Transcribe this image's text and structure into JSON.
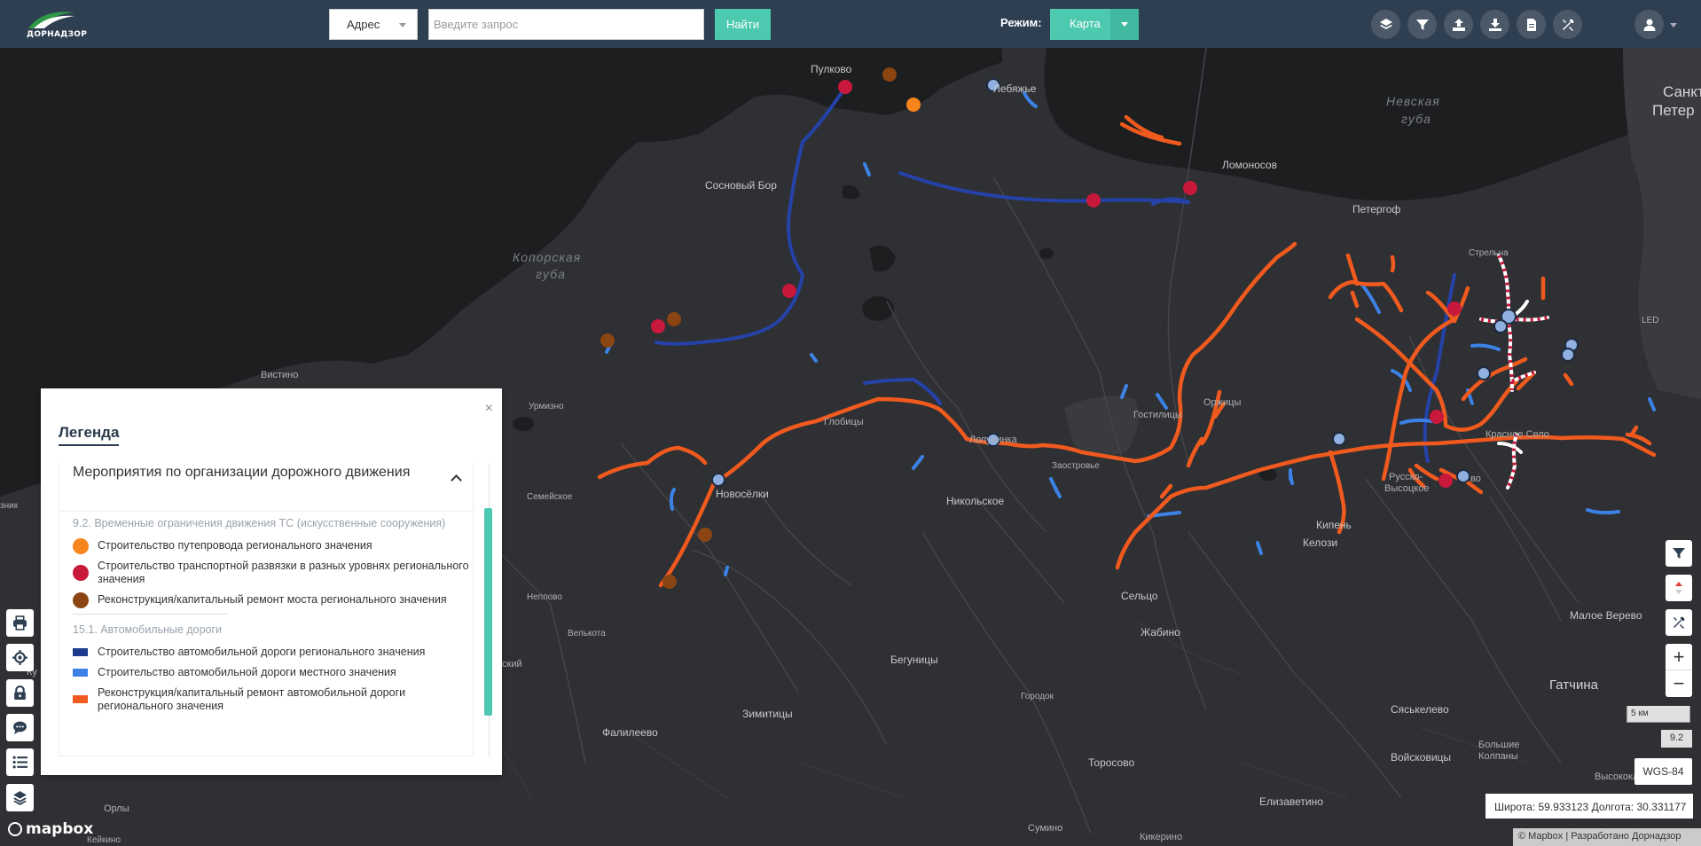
{
  "header": {
    "logo_text": "ДОРНАДЗОР",
    "address_select": "Адрес",
    "search_placeholder": "Введите запрос",
    "find_button": "Найти",
    "mode_label": "Режим:",
    "mode_value": "Карта",
    "tools": [
      "layers-icon",
      "filter-icon",
      "upload-icon",
      "download-icon",
      "document-icon",
      "tools-icon"
    ],
    "user_icon": "user-icon"
  },
  "map": {
    "labels": {
      "pulkovo": "Пулково",
      "lebyazhye": "Лебяжье",
      "nevskaya": "Невская",
      "guba": "губа",
      "sankt": "Санкт",
      "peter": "Петер",
      "lomonosov": "Ломоносов",
      "sosnovy_bor": "Сосновый Бор",
      "peterhof": "Петергоф",
      "koporskaya": "Копорская",
      "koporskaya_guba": "губа",
      "strelna": "Стрельна",
      "led": "LED",
      "vistino": "Вистино",
      "urmizno": "Урмизно",
      "lopukhinka": "Лопухинка",
      "bolshie": "Гостилицы",
      "orzhitsy": "Оржицы",
      "lobyzhye2": "Глобицы",
      "zaostrovye": "Заостровье",
      "krasnoe_selo": "Красное Село",
      "semeyskoe": "Семейское",
      "novoselki": "Новосёлки",
      "nikolskoe": "Никольское",
      "russko": "Русско-",
      "vysotskoe": "Высоцкое",
      "kipen": "Кипень",
      "kelozi": "Келози",
      "neppovo": "Неппово",
      "velkota": "Велькота",
      "selco": "Сельцо",
      "zhabino": "Жабино",
      "begunitsy": "Бегуницы",
      "zimititsy": "Зимитицы",
      "malo_verevo": "Малое Верево",
      "gatchina": "Гатчина",
      "syaskelevo": "Сяськелево",
      "voyskovitsy": "Войсковицы",
      "bolshie_kolpany": "Большие",
      "kolpany": "Колпаны",
      "falileevo": "Фалилеево",
      "gorodok": "Городок",
      "torosovo": "Торосово",
      "elizavetino": "Елизаветино",
      "orly": "Орлы",
      "keykino": "Кейкино",
      "sumino": "Сумино",
      "kikerino": "Кикерино",
      "vysokolkoe": "Высокоключевой",
      "kisk": "ский",
      "znik": "зник",
      "ku": "Ку",
      "vo": "во"
    }
  },
  "legend": {
    "title": "Легенда",
    "close": "×",
    "section_title": "Мероприятия по организации дорожного движения",
    "group1": "9.2. Временные ограничения движения ТС (искусственные сооружения)",
    "items1": [
      {
        "color": "#f7851c",
        "label": "Строительство путепровода регионального значения"
      },
      {
        "color": "#c8183c",
        "label": "Строительство транспортной развязки в разных уровнях регионального значения"
      },
      {
        "color": "#8b4513",
        "label": "Реконструкция/капитальный ремонт моста регионального значения"
      }
    ],
    "group2": "15.1. Автомобильные дороги",
    "items2": [
      {
        "color": "#1c3a8c",
        "label": "Строительство автомобильной дороги регионального значения"
      },
      {
        "color": "#3c82e6",
        "label": "Строительство автомобильной дороги местного значения"
      },
      {
        "color": "#f05a1e",
        "label": "Реконструкция/капитальный ремонт автомобильной дороги регионального значения"
      }
    ]
  },
  "left_tools": [
    "print-icon",
    "locate-icon",
    "lock-icon",
    "comment-icon",
    "list-icon",
    "layers-icon"
  ],
  "right_tools": [
    "filter-icon",
    "sort-icon",
    "tools-icon"
  ],
  "zoom": {
    "in": "+",
    "out": "−"
  },
  "scale": "5 км",
  "zoom_level": "9.2",
  "crs": "WGS-84",
  "coords": {
    "lat_label": "Широта:",
    "lat": "59.933123",
    "lon_label": "Долгота:",
    "lon": "30.331177"
  },
  "attribution": "© Mapbox | Разработано Дорнадзор",
  "mapbox_logo": "mapbox"
}
